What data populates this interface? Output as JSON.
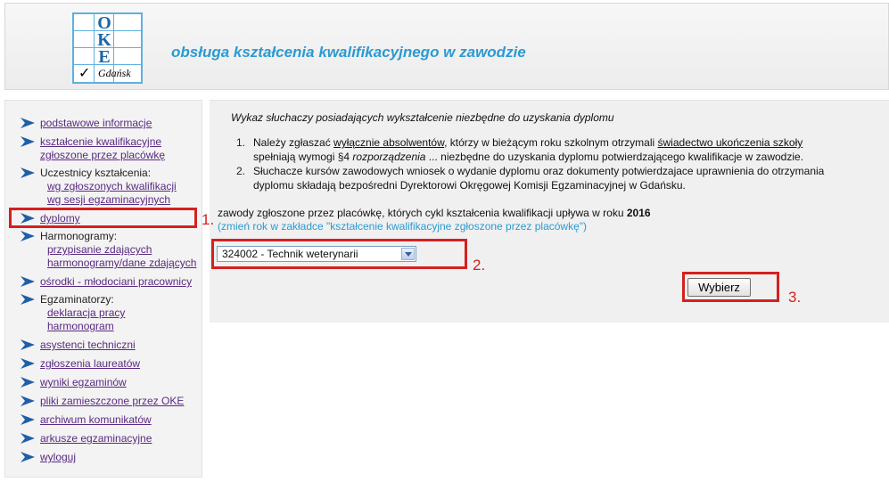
{
  "header": {
    "logo": {
      "letters": [
        "O",
        "K",
        "E"
      ],
      "city": "Gdańsk",
      "check": "✓"
    },
    "title": "obsługa kształcenia kwalifikacyjnego w zawodzie"
  },
  "sidebar": {
    "items": [
      {
        "label": "podstawowe informacje"
      },
      {
        "label_lines": [
          "kształcenie kwalifikacyjne",
          "zgłoszone przez placówkę"
        ]
      },
      {
        "label": "Uczestnicy kształcenia:",
        "sub": [
          "wg zgłoszonych kwalifikacji",
          "wg sesji egzaminacyjnych"
        ]
      },
      {
        "label": "dyplomy"
      },
      {
        "label": "Harmonogramy:",
        "sub": [
          "przypisanie zdających",
          "harmonogramy/dane zdających"
        ]
      },
      {
        "label": "ośrodki - młodociani pracownicy"
      },
      {
        "label": "Egzaminatorzy:",
        "sub": [
          "deklaracja pracy",
          "harmonogram"
        ]
      },
      {
        "label": "asystenci techniczni"
      },
      {
        "label": "zgłoszenia laureatów"
      },
      {
        "label": "wyniki egzaminów"
      },
      {
        "label": "pliki zamieszczone przez OKE"
      },
      {
        "label": "archiwum komunikatów"
      },
      {
        "label": "arkusze egzaminacyjne"
      },
      {
        "label": "wyloguj"
      }
    ]
  },
  "main": {
    "list_title": "Wykaz słuchaczy posiadających wykształcenie niezbędne do uzyskania dyplomu",
    "info": [
      {
        "num": "1.",
        "l1_a": "Należy zgłaszać ",
        "l1_u1": "wyłącznie absolwentów",
        "l1_b": ", którzy w bieżącym roku szkolnym otrzymali ",
        "l1_u2": "świadectwo ukończenia szkoły",
        "l2_a": "spełniają wymogi §4 ",
        "l2_i": "rozporządzenia",
        "l2_b": " ... niezbędne do uzyskania dyplomu potwierdzającego kwalifikacje w zawodzie."
      },
      {
        "num": "2.",
        "l1": "Słuchacze kursów zawodowych wniosek o wydanie dyplomu oraz dokumenty potwierdzajace uprawnienia do otrzymania",
        "l2": "dyplomu składają bezpośredni Dyrektorowi Okręgowej Komisji Egzaminacyjnej w Gdańsku."
      }
    ],
    "year_text": "zawody zgłoszone przez placówkę, których cykl kształcenia kwalifikacji upływa w roku",
    "year": "2016",
    "change_year_hint": "(zmień rok w zakładce \"kształcenie kwalifikacyjne zgłoszone przez placówkę\")",
    "select_value": "324002 - Technik weterynarii",
    "submit_label": "Wybierz"
  },
  "annotations": [
    "1.",
    "2.",
    "3."
  ],
  "colors": {
    "link": "#5a2a82",
    "accent": "#2b9ad2",
    "annotation": "#d52020",
    "arrow": "#1f5fa8"
  }
}
